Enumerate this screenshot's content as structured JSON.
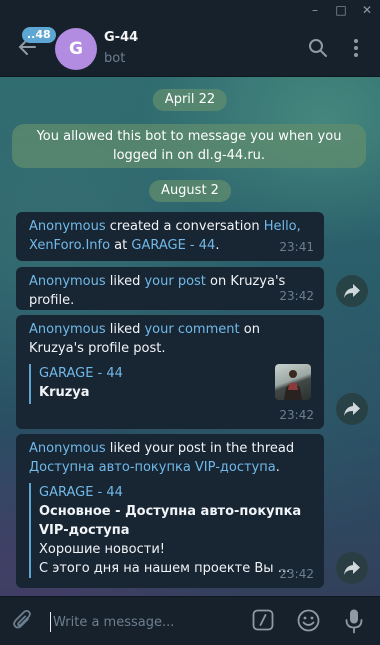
{
  "window": {
    "minimize": "–",
    "maximize": "□",
    "close": "✕"
  },
  "header": {
    "unread_count": "..48",
    "avatar_letter": "G",
    "title": "G-44",
    "subtitle": "bot"
  },
  "chat": {
    "date1": "April 22",
    "service_message": "You allowed this bot to message you when you logged in on dl.g-44.ru.",
    "date2": "August 2",
    "messages": [
      {
        "actor": "Anonymous",
        "text_mid": " created a conversation ",
        "link": "Hello, XenForo.Info",
        "text_after": " at ",
        "place": "GARAGE - 44",
        "text_end": ".",
        "time": "23:41"
      },
      {
        "actor": "Anonymous",
        "text_mid": " liked ",
        "link": "your post",
        "text_after": " on Kruzya's profile.",
        "time": "23:42"
      },
      {
        "actor": "Anonymous",
        "text_mid": " liked ",
        "link": "your comment",
        "text_after": " on Kruzya's profile post.",
        "quote_title": "GARAGE - 44",
        "quote_body": "Kruzya",
        "time": "23:42"
      },
      {
        "actor": "Anonymous",
        "text_mid": " liked your post in the thread ",
        "link": "Доступна авто-покупка VIP-доступа",
        "text_after": ".",
        "quote_title": "GARAGE - 44",
        "quote_body": "Основное - Доступна авто-покупка VIP-доступа",
        "quote_text1": "Хорошие новости!",
        "quote_text2": "С этого дня на нашем проекте Вы ...",
        "time": "23:42"
      }
    ]
  },
  "composer": {
    "placeholder": "Write a message..."
  },
  "icons": {
    "back": "arrow-left-icon",
    "search": "search-icon",
    "more": "more-vertical-icon",
    "share": "share-arrow-icon",
    "attach": "paperclip-icon",
    "commands": "bot-commands-icon",
    "emoji": "emoji-icon",
    "mic": "microphone-icon"
  },
  "colors": {
    "header_bg": "#17212b",
    "bubble_bg": "#182533",
    "link": "#71b9e8",
    "accent_badge": "#5ea6d4",
    "avatar": "#b28ce0",
    "date_pill": "#5f8c6e"
  }
}
